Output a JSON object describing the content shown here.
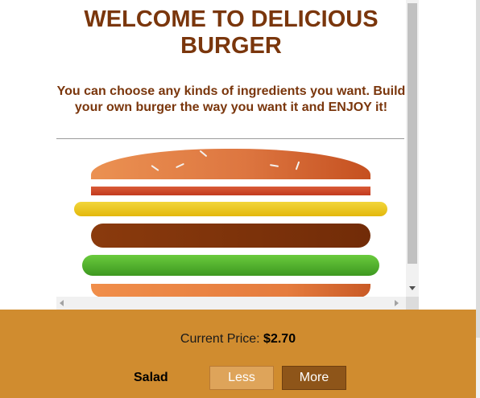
{
  "header": {
    "title": "WELCOME TO DELICIOUS BURGER",
    "subtitle": "You can choose any kinds of ingredients you want. Build your own burger the way you want it and ENJOY it!"
  },
  "burger": {
    "layers": [
      "bread-top",
      "bacon",
      "cheese",
      "meat",
      "salad",
      "bread-bottom"
    ]
  },
  "controls": {
    "price_label": "Current Price: ",
    "price_value": "$2.70",
    "ingredients": [
      {
        "label": "Salad",
        "less_label": "Less",
        "more_label": "More"
      }
    ]
  },
  "colors": {
    "title": "#7a360c",
    "panel": "#d08c2f",
    "less_button": "#dea45a",
    "more_button": "#8e5519",
    "bun": "#e07d45",
    "bacon": "#c8421f",
    "cheese": "#e9c51e",
    "meat": "#7a300a",
    "salad": "#4fb02c"
  }
}
